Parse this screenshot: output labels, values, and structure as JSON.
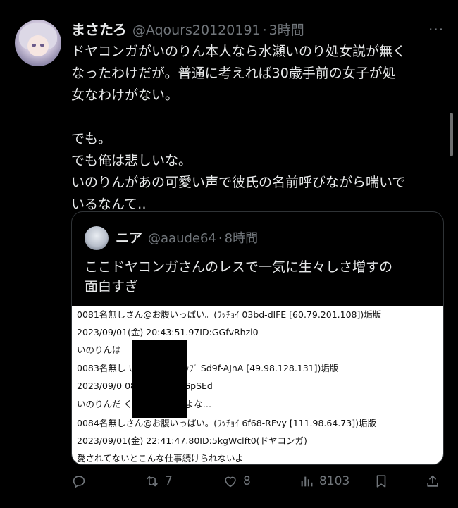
{
  "tweet": {
    "display_name": "まさたろ",
    "handle": "@Aqours20120191",
    "separator": "·",
    "time": "3時間",
    "text": "ドヤコンガがいのりん本人なら水瀬いのり処女説が無く\nなったわけだが。普通に考えれば30歳手前の女子が処\n女なわけがない。\n\nでも。\nでも俺は悲しいな。\nいのりんがあの可愛い声で彼氏の名前呼びながら喘いで\nいるなんて‥"
  },
  "quote": {
    "display_name": "ニア",
    "handle": "@aaude64",
    "separator": "·",
    "time": "8時間",
    "text": "ここドヤコンガさんのレスで一気に生々しさ増すの\n面白すぎ",
    "image_lines": [
      "0081名無しさん@お腹いっぱい。(ﾜｯﾁｮｲ 03bd-dlFE [60.79.201.108])垢版",
      "2023/09/01(金) 20:43:51.97ID:GGfvRhzl0",
      "いのりんは",
      "0083名無し            いっぱい。(ｽｯｯﾌﾟ Sd9f-AJnA [49.98.128.131])垢版",
      "2023/09/0              08.92ID:sDxzGpSEd",
      "いのりんだ              くらいはしてるよな…",
      "0084名無しさん@お腹いっぱい。(ﾜｯﾁｮｲ 6f68-RFvy [111.98.64.73])垢版",
      "2023/09/01(金) 22:41:47.80ID:5kgWclft0(ドヤコンガ)",
      "愛されてないとこんな仕事続けられないよ"
    ]
  },
  "actions": {
    "reply_count": "",
    "retweet_count": "7",
    "like_count": "8",
    "views_count": "8103"
  }
}
